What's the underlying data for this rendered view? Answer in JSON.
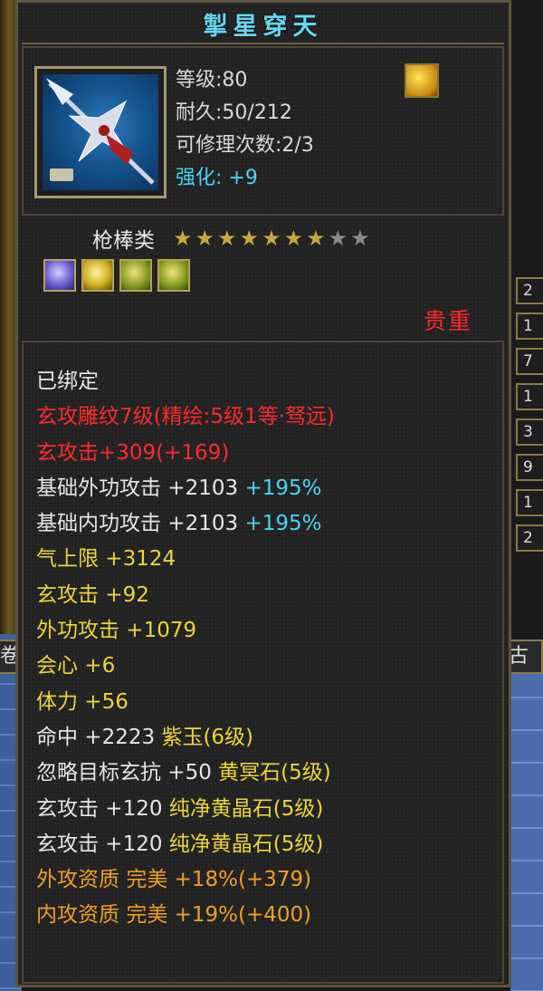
{
  "item": {
    "name": "掣星穿天",
    "level": "等级:80",
    "durability": "耐久:50/212",
    "repairs": "可修理次数:2/3",
    "enhance_label": "强化:",
    "enhance_value": "+9",
    "category": "枪棒类",
    "stars_filled": 7,
    "stars_total": 9,
    "rarity": "贵重"
  },
  "attributes": [
    {
      "parts": [
        {
          "text": "已绑定",
          "color": "white"
        }
      ]
    },
    {
      "parts": [
        {
          "text": "玄攻雕纹7级(精绘:5级1等·驽远)",
          "color": "red"
        }
      ]
    },
    {
      "parts": [
        {
          "text": "玄攻击+309(+169)",
          "color": "red"
        }
      ]
    },
    {
      "parts": [
        {
          "text": "基础外功攻击  +2103 ",
          "color": "white"
        },
        {
          "text": "+195%",
          "color": "cyan"
        }
      ]
    },
    {
      "parts": [
        {
          "text": "基础内功攻击  +2103 ",
          "color": "white"
        },
        {
          "text": "+195%",
          "color": "cyan"
        }
      ]
    },
    {
      "parts": [
        {
          "text": "气上限  +3124",
          "color": "yellow"
        }
      ]
    },
    {
      "parts": [
        {
          "text": "玄攻击  +92",
          "color": "yellow"
        }
      ]
    },
    {
      "parts": [
        {
          "text": "外功攻击  +1079",
          "color": "yellow"
        }
      ]
    },
    {
      "parts": [
        {
          "text": "会心  +6",
          "color": "yellow"
        }
      ]
    },
    {
      "parts": [
        {
          "text": "体力  +56",
          "color": "yellow"
        }
      ]
    },
    {
      "parts": [
        {
          "text": "命中  +2223 ",
          "color": "white"
        },
        {
          "text": "紫玉(6级)",
          "color": "yellow"
        }
      ]
    },
    {
      "parts": [
        {
          "text": "忽略目标玄抗  +50 ",
          "color": "white"
        },
        {
          "text": "黄冥石(5级)",
          "color": "yellow"
        }
      ]
    },
    {
      "parts": [
        {
          "text": "玄攻击  +120 ",
          "color": "white"
        },
        {
          "text": "纯净黄晶石(5级)",
          "color": "yellow"
        }
      ]
    },
    {
      "parts": [
        {
          "text": "玄攻击  +120 ",
          "color": "white"
        },
        {
          "text": "纯净黄晶石(5级)",
          "color": "yellow"
        }
      ]
    },
    {
      "parts": [
        {
          "text": "外攻资质   ",
          "color": "orange"
        },
        {
          "text": "完美  +18%(+379)",
          "color": "orange"
        }
      ]
    },
    {
      "parts": [
        {
          "text": "内攻资质   ",
          "color": "orange"
        },
        {
          "text": "完美  +19%(+400)",
          "color": "orange"
        }
      ]
    }
  ],
  "side_tabs": [
    "2",
    "1",
    "7",
    "1",
    "3",
    "9",
    "1",
    "2"
  ],
  "edge_right_label": "古情",
  "edge_left_label": "卷",
  "icons": {
    "item": "spear-icon",
    "badge": "gold-flame-icon",
    "gems": [
      "purple-gem-icon",
      "yellow-gem-icon",
      "green-gem-icon",
      "green-gem-icon"
    ]
  },
  "colors": {
    "title": "#66d8f2",
    "red": "#ff2a2a",
    "cyan": "#49d3f5",
    "yellow": "#ecd43a",
    "orange": "#f0a020",
    "white": "#e6e6e6"
  }
}
